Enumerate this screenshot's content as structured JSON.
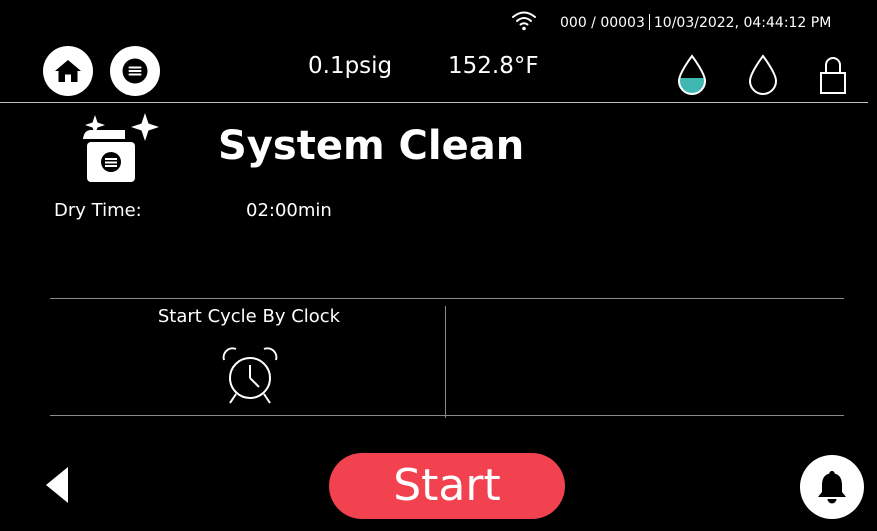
{
  "status_bar": {
    "counter": "000 / 00003",
    "datetime": "10/03/2022, 04:44:12 PM"
  },
  "header": {
    "pressure": "0.1psig",
    "temperature": "152.8°F"
  },
  "cycle": {
    "title": "System Clean",
    "dry_time_label": "Dry Time:",
    "dry_time_value": "02:00min"
  },
  "start_by_clock": {
    "label": "Start Cycle By Clock"
  },
  "footer": {
    "start_label": "Start"
  },
  "icons": {
    "home": "home-icon",
    "menu": "menu-icon",
    "wifi": "wifi-icon",
    "water_reservoir": "water-drop-filled-icon",
    "waste_reservoir": "water-drop-empty-icon",
    "lock": "lock-icon",
    "cycle": "sparkle-container-icon",
    "clock": "alarm-clock-icon",
    "back": "back-arrow-icon",
    "alarm": "bell-icon"
  },
  "colors": {
    "background": "#000000",
    "start_button": "#f2424f",
    "water_fill": "#3fb8b1"
  }
}
